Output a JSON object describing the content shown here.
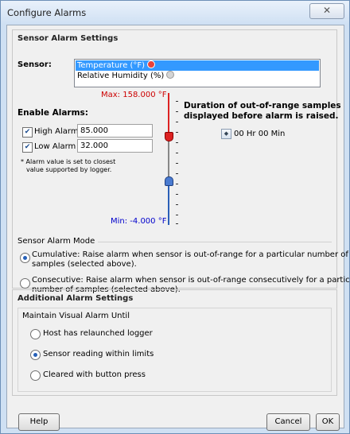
{
  "window": {
    "title": "Configure Alarms"
  },
  "sensor_section": {
    "title": "Sensor Alarm Settings",
    "sensor_label": "Sensor:",
    "sensors": [
      {
        "label": "Temperature (°F)",
        "selected": true,
        "dot_color": "#e8423a"
      },
      {
        "label": "Relative Humidity (%)",
        "selected": false,
        "dot_color": "#c9c9c9"
      }
    ],
    "max_label": "Max: 158.000 °F",
    "min_label": "Min: -4.000 °F",
    "enable_alarms_label": "Enable Alarms:",
    "high_alarm": {
      "label": "High Alarm",
      "value": "85.000",
      "checked": true
    },
    "low_alarm": {
      "label": "Low Alarm",
      "value": "32.000",
      "checked": true
    },
    "note_line1": "* Alarm value is set to closest",
    "note_line2": "value supported by logger.",
    "duration_line1": "Duration of out-of-range samples",
    "duration_line2": "displayed before alarm is raised.",
    "duration_value": "00 Hr 00 Min",
    "mode_title": "Sensor Alarm Mode",
    "cumulative_line1": "Cumulative: Raise alarm when sensor is out-of-range for a particular number of",
    "cumulative_line2": "samples (selected above).",
    "consecutive_line1": "Consecutive: Raise alarm when sensor is out-of-range consecutively for a particular",
    "consecutive_line2": "number of samples (selected above).",
    "selected_mode": "cumulative"
  },
  "additional_section": {
    "title": "Additional Alarm Settings",
    "maintain_title": "Maintain Visual Alarm Until",
    "options": [
      {
        "label": "Host has relaunched logger",
        "selected": false
      },
      {
        "label": "Sensor reading within limits",
        "selected": true
      },
      {
        "label": "Cleared with button press",
        "selected": false
      }
    ]
  },
  "buttons": {
    "help": "Help",
    "cancel": "Cancel",
    "ok": "OK",
    "close": "✕"
  },
  "colors": {
    "max_red": "#cc0000",
    "min_blue": "#0000cc",
    "selection": "#3399ff"
  }
}
